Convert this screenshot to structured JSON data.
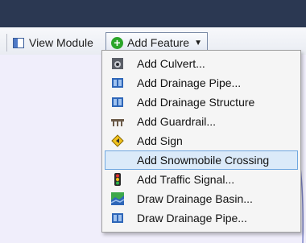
{
  "toolbar": {
    "view_module_label": "View Module",
    "add_feature_label": "Add Feature"
  },
  "menu": {
    "items": [
      {
        "label": "Add Culvert...",
        "icon": "culvert-icon",
        "selected": false
      },
      {
        "label": "Add Drainage Pipe...",
        "icon": "drainage-pipe-icon",
        "selected": false
      },
      {
        "label": "Add Drainage Structure",
        "icon": "drainage-structure-icon",
        "selected": false
      },
      {
        "label": "Add Guardrail...",
        "icon": "guardrail-icon",
        "selected": false
      },
      {
        "label": "Add Sign",
        "icon": "sign-icon",
        "selected": false
      },
      {
        "label": "Add Snowmobile Crossing",
        "icon": "",
        "selected": true
      },
      {
        "label": "Add Traffic Signal...",
        "icon": "traffic-signal-icon",
        "selected": false
      },
      {
        "label": "Draw Drainage Basin...",
        "icon": "drainage-basin-icon",
        "selected": false
      },
      {
        "label": "Draw Drainage Pipe...",
        "icon": "drainage-pipe-icon",
        "selected": false
      }
    ]
  },
  "colors": {
    "topbar": "#2b3852",
    "menu_selection": "#dbeaf9",
    "workspace": "#f0eefb"
  }
}
